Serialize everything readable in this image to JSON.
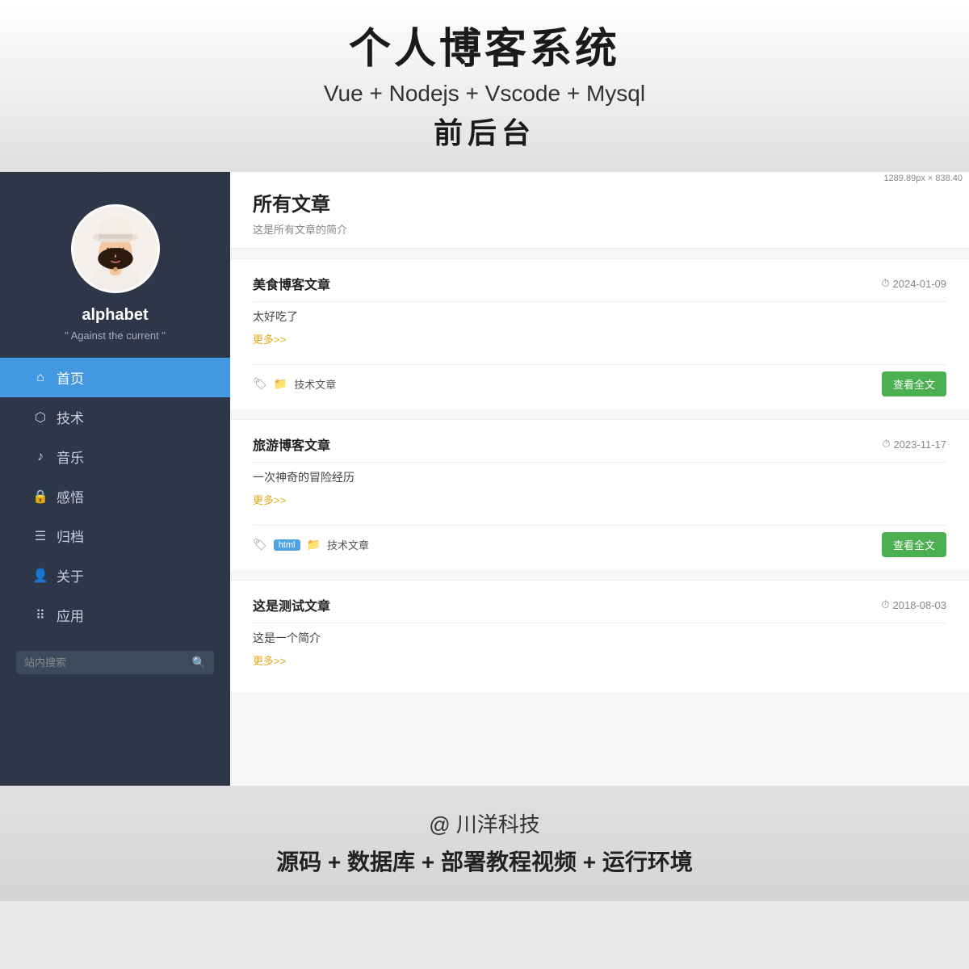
{
  "top_banner": {
    "main_title": "个人博客系统",
    "sub_title": "Vue + Nodejs + Vscode + Mysql",
    "sub_title2": "前后台"
  },
  "dimension_label": "1289.89px × 838.40",
  "sidebar": {
    "username": "alphabet",
    "motto": "\" Against the current \"",
    "nav_items": [
      {
        "id": "home",
        "icon": "⌂",
        "label": "首页",
        "active": true
      },
      {
        "id": "tech",
        "icon": "⬡",
        "label": "技术",
        "active": false
      },
      {
        "id": "music",
        "icon": "♪",
        "label": "音乐",
        "active": false
      },
      {
        "id": "insight",
        "icon": "🔒",
        "label": "感悟",
        "active": false
      },
      {
        "id": "archive",
        "icon": "☰",
        "label": "归档",
        "active": false
      },
      {
        "id": "about",
        "icon": "👤",
        "label": "关于",
        "active": false
      },
      {
        "id": "apps",
        "icon": "⠿",
        "label": "应用",
        "active": false
      }
    ],
    "search_placeholder": "站内搜索"
  },
  "page_header": {
    "title": "所有文章",
    "desc": "这是所有文章的简介"
  },
  "articles": [
    {
      "id": 1,
      "title": "美食博客文章",
      "date": "2024-01-09",
      "excerpt": "太好吃了",
      "more_label": "更多>>",
      "tags": [],
      "category": "技术文章",
      "btn_label": "查看全文"
    },
    {
      "id": 2,
      "title": "旅游博客文章",
      "date": "2023-11-17",
      "excerpt": "一次神奇的冒险经历",
      "more_label": "更多>>",
      "tags": [
        "html"
      ],
      "category": "技术文章",
      "btn_label": "查看全文"
    },
    {
      "id": 3,
      "title": "这是测试文章",
      "date": "2018-08-03",
      "excerpt": "这是一个简介",
      "more_label": "更多>>",
      "tags": [],
      "category": "",
      "btn_label": ""
    }
  ],
  "bottom_banner": {
    "brand_text": "@ 川洋科技",
    "promo_text": "源码 + 数据库 + 部署教程视频 + 运行环境"
  }
}
